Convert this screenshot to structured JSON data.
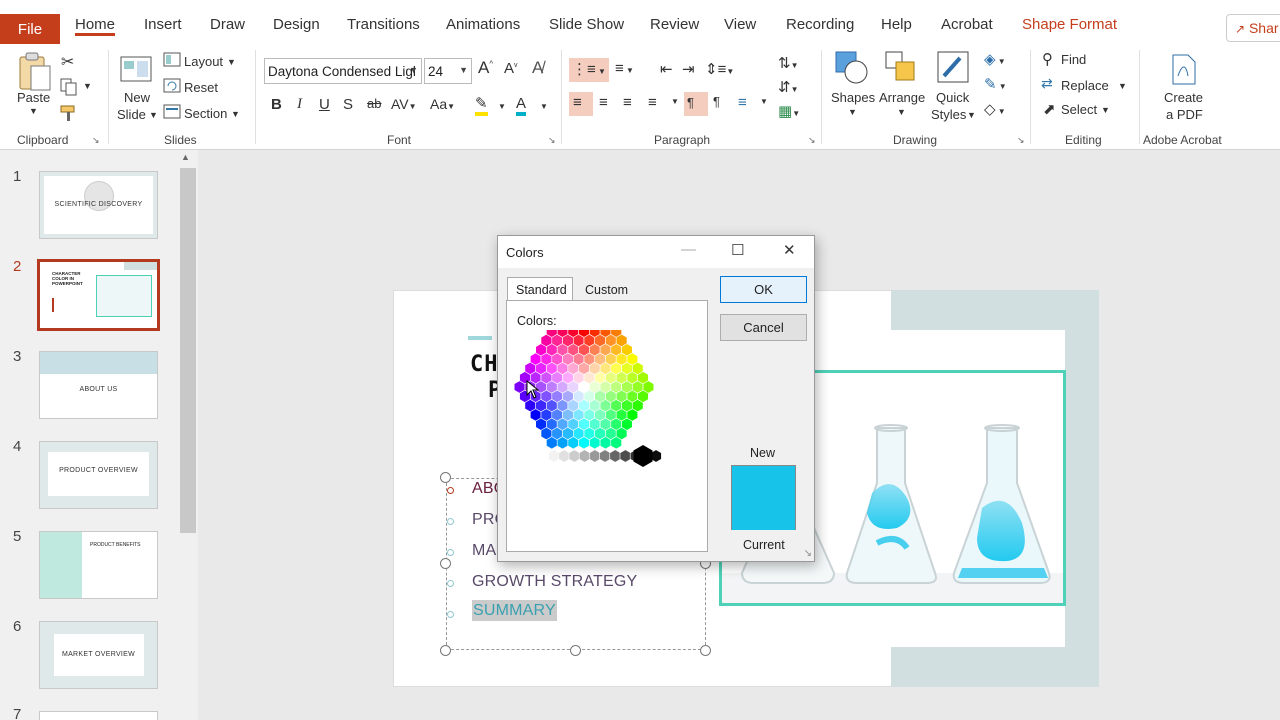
{
  "tabs": {
    "file": "File",
    "items": [
      "Home",
      "Insert",
      "Draw",
      "Design",
      "Transitions",
      "Animations",
      "Slide Show",
      "Review",
      "View",
      "Recording",
      "Help",
      "Acrobat"
    ],
    "contextual": "Shape Format",
    "share": "Shar"
  },
  "ribbon": {
    "clipboard": {
      "paste": "Paste",
      "label": "Clipboard"
    },
    "slides": {
      "new_slide_1": "New",
      "new_slide_2": "Slide",
      "layout": "Layout",
      "reset": "Reset",
      "section": "Section",
      "label": "Slides"
    },
    "font": {
      "name": "Daytona Condensed Ligl",
      "size": "24",
      "label": "Font"
    },
    "paragraph": {
      "label": "Paragraph"
    },
    "drawing": {
      "shapes": "Shapes",
      "arrange": "Arrange",
      "quick_styles_1": "Quick",
      "quick_styles_2": "Styles",
      "label": "Drawing"
    },
    "editing": {
      "find": "Find",
      "replace": "Replace",
      "select": "Select",
      "label": "Editing"
    },
    "acrobat": {
      "create_1": "Create",
      "create_2": "a PDF",
      "label": "Adobe Acrobat"
    }
  },
  "thumbnails": [
    {
      "num": "1",
      "title": "SCIENTIFIC DISCOVERY"
    },
    {
      "num": "2",
      "title": "CHARACTER COLOR IN POWERPOINT"
    },
    {
      "num": "3",
      "title": "ABOUT US"
    },
    {
      "num": "4",
      "title": "PRODUCT OVERVIEW"
    },
    {
      "num": "5",
      "title": "PRODUCT BENEFITS"
    },
    {
      "num": "6",
      "title": "MARKET OVERVIEW"
    },
    {
      "num": "7",
      "title": ""
    }
  ],
  "slide": {
    "title_line1": "CH",
    "title_line2": "P",
    "bullets": [
      "ABO",
      "PRO",
      "MAR",
      "GROWTH STRATEGY",
      "SUMMARY"
    ]
  },
  "dialog": {
    "title": "Colors",
    "tab_standard": "Standard",
    "tab_custom": "Custom",
    "colors_label": "Colors:",
    "ok": "OK",
    "cancel": "Cancel",
    "new_label": "New",
    "current_label": "Current",
    "new_color": "#18c3ea"
  },
  "colors": {
    "accent": "#c43e1c",
    "teal_frame": "#4fd1b8",
    "deco": "#d2dfe0"
  }
}
